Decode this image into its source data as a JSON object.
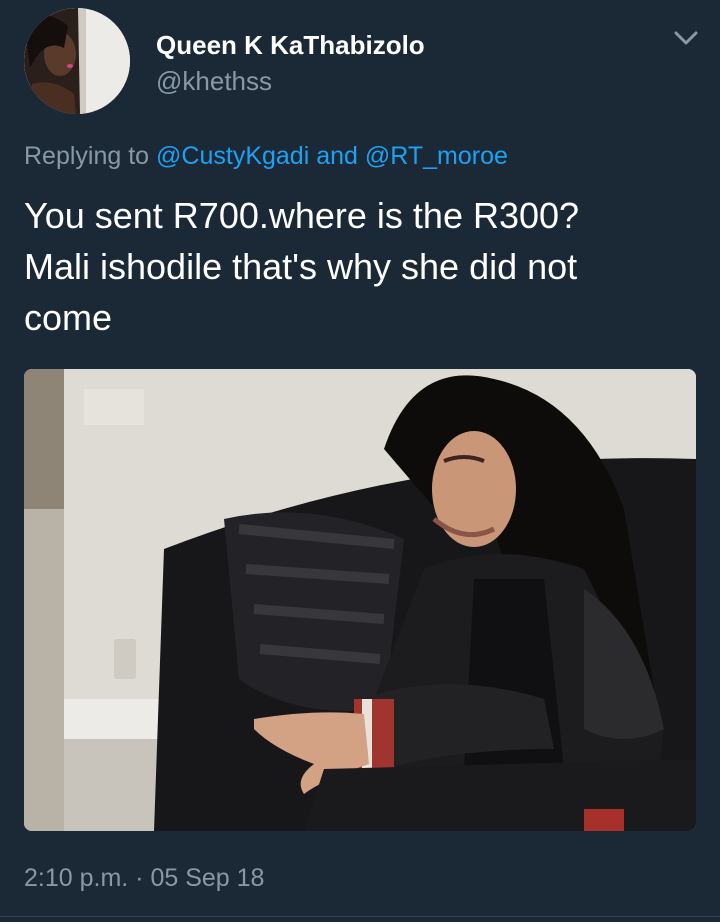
{
  "tweet": {
    "author": {
      "display_name": "Queen K KaThabizolo",
      "handle": "@khethss",
      "avatar_icon": "profile-photo"
    },
    "replying": {
      "prefix": "Replying to ",
      "mention_1": "@CustyKgadi",
      "joiner": " and ",
      "mention_2": "@RT_moroe"
    },
    "text": "You sent R700.where is the R300?\nMali ishodile that's why she did not\ncome",
    "media": {
      "icon": "photo-woman-on-couch"
    },
    "timestamp": "2:10 p.m. · 05 Sep 18",
    "menu_icon": "chevron-down-icon"
  },
  "colors": {
    "background": "#1b2836",
    "text_primary": "#ffffff",
    "text_secondary": "#8899a6",
    "link": "#1da1f2"
  }
}
